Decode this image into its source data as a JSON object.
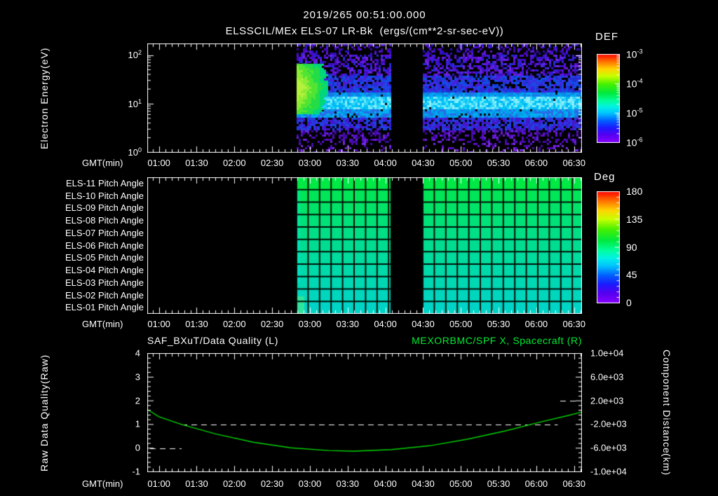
{
  "header": {
    "title": "2019/265 00:51:00.000",
    "subtitle": "ELSSCIL/MEx ELS-07 LR-Bk  (ergs/(cm**2-sr-sec-eV))"
  },
  "time_axis": {
    "label": "GMT(min)",
    "tick_labels": [
      "01:00",
      "01:30",
      "02:00",
      "02:30",
      "03:00",
      "03:30",
      "04:00",
      "04:30",
      "05:00",
      "05:30",
      "06:00",
      "06:30"
    ],
    "start_min": 51,
    "end_min": 396,
    "minor_step_min": 5,
    "major_step_min": 30
  },
  "spectrogram_panel": {
    "ylabel_lines": [
      "Electron Energy",
      "(eV)"
    ],
    "yticks": [
      {
        "base": "10",
        "exp": "2",
        "log": 2
      },
      {
        "base": "10",
        "exp": "1",
        "log": 1
      },
      {
        "base": "10",
        "exp": "0",
        "log": 0
      }
    ],
    "colorbar": {
      "title": "DEF",
      "labels": [
        {
          "base": "10",
          "exp": "-3"
        },
        {
          "base": "10",
          "exp": "-4"
        },
        {
          "base": "10",
          "exp": "-5"
        },
        {
          "base": "10",
          "exp": "-6"
        }
      ]
    }
  },
  "pitch_panel": {
    "row_labels": [
      "ELS-11 Pitch Angle",
      "ELS-10 Pitch Angle",
      "ELS-09 Pitch Angle",
      "ELS-08 Pitch Angle",
      "ELS-07 Pitch Angle",
      "ELS-06 Pitch Angle",
      "ELS-05 Pitch Angle",
      "ELS-04 Pitch Angle",
      "ELS-03 Pitch Angle",
      "ELS-02 Pitch Angle",
      "ELS-01 Pitch Angle"
    ],
    "colorbar": {
      "title": "Deg",
      "labels": [
        "180",
        "135",
        "90",
        "45",
        "0"
      ]
    }
  },
  "bottom_panel": {
    "title_left": "SAF_BXuT/Data Quality (L)",
    "title_right": "MEXORBMC/SPF X, Spacecraft (R)",
    "ylabel_left_lines": [
      "Raw Data Quality",
      "(Raw)"
    ],
    "yticks_left": [
      "4",
      "3",
      "2",
      "1",
      "0",
      "-1"
    ],
    "ylabel_right_lines": [
      "Component Distance",
      "(km)"
    ],
    "yticks_right": [
      "1.0e+04",
      "6.0e+03",
      "2.0e+03",
      "-2.0e+03",
      "-6.0e+03",
      "-1.0e+04"
    ]
  },
  "colors": {
    "background": "#000000",
    "text": "#ffffff",
    "title_green": "#00ee33",
    "curve_green": "#00d400",
    "rainbow": [
      [
        0,
        "#ff0000"
      ],
      [
        0.08,
        "#ff6a00"
      ],
      [
        0.17,
        "#ffd400"
      ],
      [
        0.25,
        "#c8ff00"
      ],
      [
        0.34,
        "#46f000"
      ],
      [
        0.44,
        "#00e93e"
      ],
      [
        0.53,
        "#00ffa0"
      ],
      [
        0.6,
        "#00f0e8"
      ],
      [
        0.67,
        "#00c0ff"
      ],
      [
        0.75,
        "#0060ff"
      ],
      [
        0.83,
        "#1b1bff"
      ],
      [
        0.91,
        "#5500f0"
      ],
      [
        1,
        "#8a00ff"
      ]
    ]
  },
  "chart_data": [
    {
      "type": "heatmap",
      "name": "electron-energy-spectrogram",
      "title": "ELSSCIL/MEx ELS-07 LR-Bk",
      "units": "ergs/(cm**2-sr-sec-eV)",
      "colorbar_label": "DEF",
      "color_scale": "log",
      "color_range_log10": [
        -6,
        -3
      ],
      "y_axis": {
        "label": "Electron Energy (eV)",
        "scale": "log",
        "range_eV": [
          1,
          170
        ]
      },
      "x_axis": {
        "label": "GMT(min)",
        "range_min": [
          51,
          396
        ]
      },
      "data_segments_min": [
        [
          169.5,
          244
        ],
        [
          270,
          396
        ]
      ],
      "features": [
        {
          "desc": "persistent band 5-20 eV across both segments",
          "flux_log10": -4.6
        },
        {
          "desc": "bright burst 02:50-03:10 spanning 5-60 eV",
          "flux_log10": -3.8
        },
        {
          "desc": "diffuse speckled background above 30 eV and below 3 eV",
          "flux_log10": -5.8
        },
        {
          "desc": "data gap 04:04-04:30 and no data before 02:50",
          "flux_log10": null
        }
      ],
      "render": {
        "bands": [
          {
            "y0": 0.0,
            "y1": 0.1,
            "density": 0.35,
            "colors": [
              "#4a0ac8",
              "#5a18d8",
              "#3a08a8",
              "#2a10c0"
            ]
          },
          {
            "y0": 0.1,
            "y1": 0.28,
            "density": 0.55,
            "colors": [
              "#5a10d8",
              "#4408c0",
              "#6a22e0",
              "#3214c8",
              "#2828d8"
            ]
          },
          {
            "y0": 0.28,
            "y1": 0.44,
            "density": 0.85,
            "colors": [
              "#3a2ae0",
              "#2244e8",
              "#1a30d0",
              "#4a1ad8",
              "#0a50e0"
            ]
          },
          {
            "y0": 0.44,
            "y1": 0.475,
            "density": 0.97,
            "colors": [
              "#0090e8",
              "#00a8f0",
              "#1a78e8"
            ]
          },
          {
            "y0": 0.475,
            "y1": 0.6,
            "density": 0.985,
            "colors": [
              "#00b4f4",
              "#30d4f8",
              "#62e6fa",
              "#00c6f6",
              "#8ceefc"
            ]
          },
          {
            "y0": 0.6,
            "y1": 0.665,
            "density": 0.95,
            "colors": [
              "#009ae8",
              "#00b0f0",
              "#2a6ae8"
            ]
          },
          {
            "y0": 0.665,
            "y1": 0.78,
            "density": 0.8,
            "colors": [
              "#2a34e0",
              "#3a1cd0",
              "#1a46e0",
              "#4a14c8"
            ]
          },
          {
            "y0": 0.78,
            "y1": 0.9,
            "density": 0.4,
            "colors": [
              "#5a10c8",
              "#4a08b0",
              "#6a22d8",
              "#3a08a0"
            ]
          },
          {
            "y0": 0.9,
            "y1": 1.0,
            "density": 0.22,
            "colors": [
              "#5a10c8",
              "#7a2ae0",
              "#4a08b0"
            ]
          }
        ],
        "blob": {
          "t0": 169.5,
          "t1": 200,
          "y0": 0.17,
          "y1": 0.63,
          "palette": [
            "#00ccb4",
            "#00d67c",
            "#22dc48",
            "#52e432",
            "#8cec34",
            "#b4f03c"
          ]
        }
      }
    },
    {
      "type": "heatmap",
      "name": "pitch-angle-panels",
      "rows": [
        "ELS-11",
        "ELS-10",
        "ELS-09",
        "ELS-08",
        "ELS-07",
        "ELS-06",
        "ELS-05",
        "ELS-04",
        "ELS-03",
        "ELS-02",
        "ELS-01"
      ],
      "colorbar_label": "Deg",
      "value_range_deg": [
        0,
        180
      ],
      "row_values_deg_approx": [
        112,
        108,
        104,
        100,
        96,
        92,
        88,
        84,
        80,
        77,
        74
      ],
      "row_colors": [
        "#00e945",
        "#00e658",
        "#00e368",
        "#00e178",
        "#00df86",
        "#00dd92",
        "#00db9e",
        "#00d9a9",
        "#00d8b3",
        "#00d6bd",
        "#00d4c6"
      ],
      "data_segments_min": [
        [
          169.5,
          244
        ],
        [
          270,
          396
        ]
      ],
      "grid": true
    },
    {
      "type": "line",
      "name": "quality-and-distance",
      "title_left": "SAF_BXuT/Data Quality (L)",
      "title_right": "MEXORBMC/SPF X, Spacecraft (R)",
      "x_axis": {
        "label": "GMT(min)",
        "range_min": [
          51,
          396
        ]
      },
      "left_axis": {
        "label": "Raw Data Quality (Raw)",
        "range": [
          -1,
          4
        ]
      },
      "right_axis": {
        "label": "Component Distance (km)",
        "range": [
          -10000,
          10000
        ]
      },
      "series": [
        {
          "name": "MEXORBMC/SPF X, Spacecraft",
          "axis": "right",
          "style": "solid",
          "color": "#00d400",
          "points_min_km": [
            [
              51,
              500
            ],
            [
              60,
              -700
            ],
            [
              78,
              -2000
            ],
            [
              105,
              -3600
            ],
            [
              135,
              -5000
            ],
            [
              165,
              -5950
            ],
            [
              195,
              -6400
            ],
            [
              215,
              -6500
            ],
            [
              245,
              -6250
            ],
            [
              275,
              -5600
            ],
            [
              305,
              -4500
            ],
            [
              335,
              -3100
            ],
            [
              365,
              -1500
            ],
            [
              385,
              -500
            ],
            [
              396,
              100
            ]
          ]
        },
        {
          "name": "SAF_BXuT/Data Quality",
          "axis": "left",
          "style": "dashed",
          "color": "#ffffff",
          "steps_min_value": [
            {
              "from": 53,
              "to": 78,
              "value": 0
            },
            {
              "from": 78,
              "to": 377,
              "value": 1
            },
            {
              "from": 379,
              "to": 393,
              "value": 2
            }
          ]
        }
      ]
    }
  ]
}
